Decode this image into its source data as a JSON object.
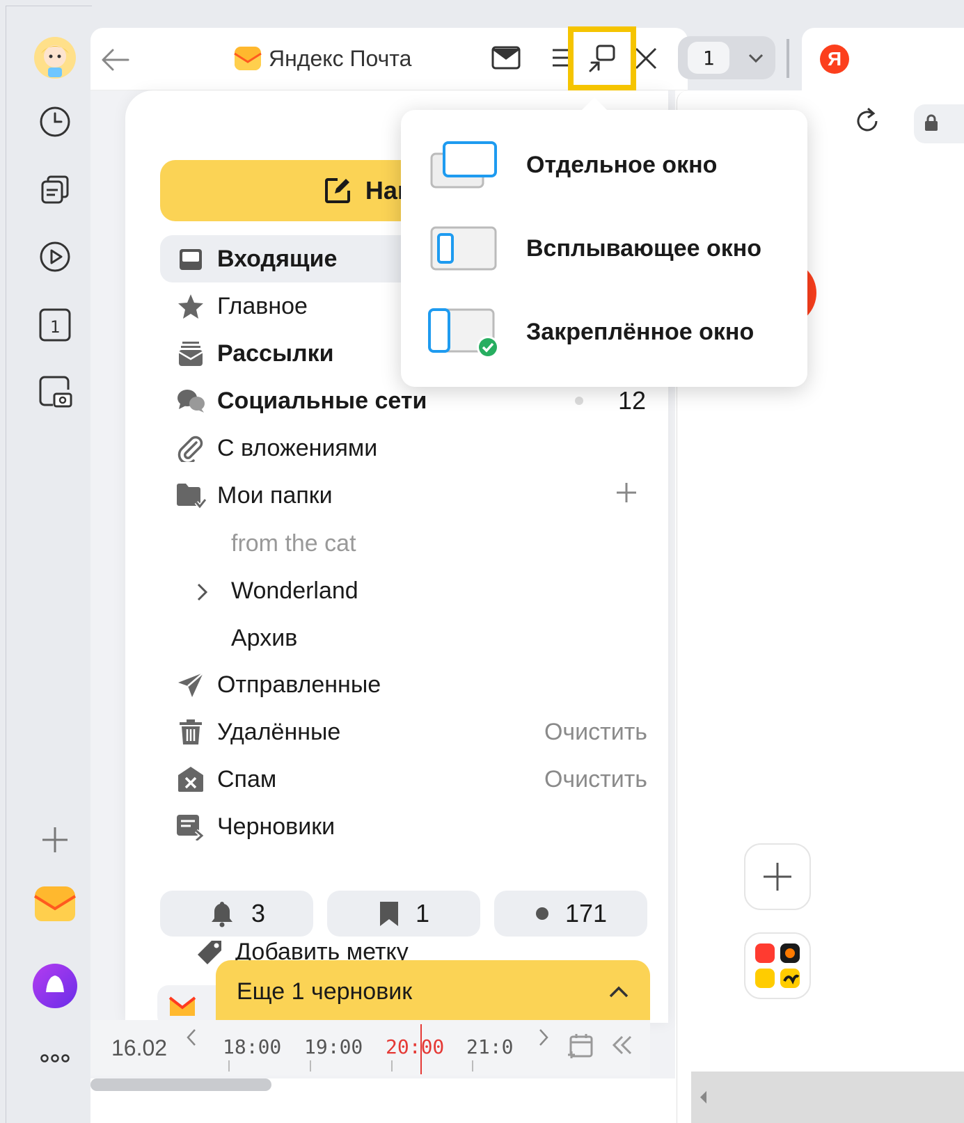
{
  "app": {
    "title": "Яндекс Почта",
    "accent": "#fbd355",
    "highlight_color": "#f5c400"
  },
  "appbar": {
    "items": [
      {
        "name": "avatar"
      },
      {
        "name": "history-icon"
      },
      {
        "name": "collections-icon"
      },
      {
        "name": "video-icon"
      },
      {
        "name": "calendar-icon",
        "text": "1"
      },
      {
        "name": "screenshot-icon"
      }
    ],
    "bottom": [
      {
        "name": "add-icon"
      },
      {
        "name": "mail-icon"
      },
      {
        "name": "alice-icon"
      },
      {
        "name": "more-icon",
        "text": "ooo"
      }
    ]
  },
  "header": {
    "title": "Яндекс Почта"
  },
  "compose": {
    "label": "Написать"
  },
  "folders": [
    {
      "label": "Входящие",
      "icon": "inbox-icon",
      "bold": true
    },
    {
      "label": "Главное",
      "icon": "star-icon",
      "bold": false
    },
    {
      "label": "Рассылки",
      "icon": "newsletters-icon",
      "bold": true
    },
    {
      "label": "Социальные сети",
      "icon": "social-icon",
      "bold": true,
      "count": "12"
    },
    {
      "label": "С вложениями",
      "icon": "attachment-icon",
      "bold": false
    },
    {
      "label": "Мои папки",
      "icon": "folder-icon",
      "bold": false
    }
  ],
  "subfolders": [
    {
      "label": "from the cat",
      "muted": true
    },
    {
      "label": "Wonderland",
      "muted": false
    },
    {
      "label": "Архив",
      "muted": false
    }
  ],
  "system_folders": [
    {
      "label": "Отправленные",
      "icon": "sent-icon"
    },
    {
      "label": "Удалённые",
      "icon": "trash-icon",
      "action": "Очистить"
    },
    {
      "label": "Спам",
      "icon": "spam-icon",
      "action": "Очистить"
    },
    {
      "label": "Черновики",
      "icon": "drafts-icon"
    }
  ],
  "chips": [
    {
      "icon": "bell-icon",
      "value": "3"
    },
    {
      "icon": "bookmark-icon",
      "value": "1"
    },
    {
      "icon": "dot-icon",
      "value": "171"
    }
  ],
  "add_label": "Добавить метку",
  "drafts_bar": "Еще 1 черновик",
  "timeline": {
    "date": "16.02",
    "times": [
      "18:00",
      "19:00",
      "20:00",
      "21:0"
    ],
    "current_color": "#e53935"
  },
  "tabs": {
    "counter": "1",
    "yandex_letter": "Я"
  },
  "menu": {
    "items": [
      {
        "label": "Отдельное окно",
        "icon": "separate-window-icon"
      },
      {
        "label": "Всплывающее окно",
        "icon": "popup-window-icon"
      },
      {
        "label": "Закреплённое окно",
        "icon": "pinned-window-icon"
      }
    ]
  }
}
